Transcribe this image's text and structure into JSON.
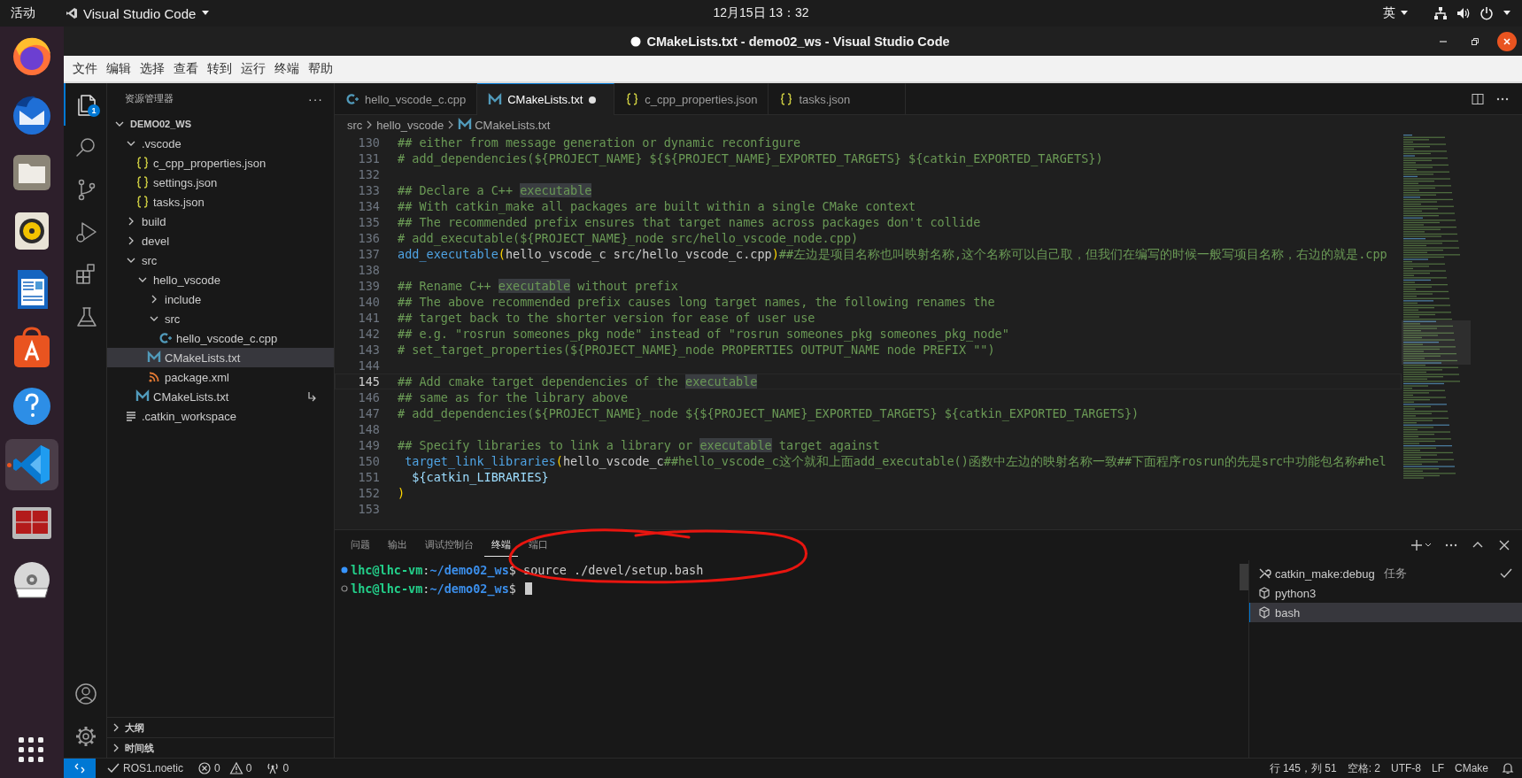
{
  "top_bar": {
    "activities": "活动",
    "app_menu": "Visual Studio Code",
    "clock": "12月15日 13：32",
    "input_method": "英"
  },
  "dock": {
    "items": [
      {
        "kind": "browser",
        "active": false
      },
      {
        "kind": "mail",
        "active": false
      },
      {
        "kind": "files",
        "active": false
      },
      {
        "kind": "music",
        "active": false
      },
      {
        "kind": "writer",
        "active": false
      },
      {
        "kind": "store",
        "active": false
      },
      {
        "kind": "help",
        "active": false
      },
      {
        "kind": "editor",
        "active": true
      },
      {
        "kind": "terminal",
        "active": false
      },
      {
        "kind": "disc",
        "active": false
      }
    ]
  },
  "window": {
    "title": "CMakeLists.txt - demo02_ws - Visual Studio Code",
    "modified": true
  },
  "menu": [
    "文件",
    "编辑",
    "选择",
    "查看",
    "转到",
    "运行",
    "终端",
    "帮助"
  ],
  "activity_bar": {
    "items": [
      {
        "kind": "explorer",
        "selected": true,
        "badge": "1"
      },
      {
        "kind": "search",
        "selected": false
      },
      {
        "kind": "scm",
        "selected": false
      },
      {
        "kind": "debug",
        "selected": false
      },
      {
        "kind": "extensions",
        "selected": false
      },
      {
        "kind": "testing",
        "selected": false
      }
    ]
  },
  "sidebar": {
    "title": "资源管理器",
    "more": "···",
    "tree": [
      {
        "label": "DEMO02_WS",
        "kind": "root",
        "expanded": true,
        "selected": false,
        "children": [
          {
            "label": ".vscode",
            "kind": "folder",
            "expanded": true,
            "selected": false,
            "children": [
              {
                "label": "c_cpp_properties.json",
                "kind": "json",
                "selected": false
              },
              {
                "label": "settings.json",
                "kind": "json",
                "selected": false
              },
              {
                "label": "tasks.json",
                "kind": "json",
                "selected": false
              }
            ]
          },
          {
            "label": "build",
            "kind": "folder",
            "expanded": false,
            "selected": false
          },
          {
            "label": "devel",
            "kind": "folder",
            "expanded": false,
            "selected": false
          },
          {
            "label": "src",
            "kind": "folder",
            "expanded": true,
            "selected": false,
            "children": [
              {
                "label": "hello_vscode",
                "kind": "folder",
                "expanded": true,
                "selected": false,
                "children": [
                  {
                    "label": "include",
                    "kind": "folder",
                    "expanded": false,
                    "selected": false
                  },
                  {
                    "label": "src",
                    "kind": "folder",
                    "expanded": true,
                    "selected": false,
                    "children": [
                      {
                        "label": "hello_vscode_c.cpp",
                        "kind": "cpp",
                        "selected": false
                      }
                    ]
                  },
                  {
                    "label": "CMakeLists.txt",
                    "kind": "cmake",
                    "selected": true
                  },
                  {
                    "label": "package.xml",
                    "kind": "xml",
                    "selected": false
                  }
                ]
              },
              {
                "label": "CMakeLists.txt",
                "kind": "cmake",
                "selected": false,
                "symlink": true
              }
            ]
          },
          {
            "label": ".catkin_workspace",
            "kind": "text",
            "selected": false
          }
        ]
      }
    ],
    "sections": [
      {
        "label": "大纲",
        "expanded": false
      },
      {
        "label": "时间线",
        "expanded": false
      }
    ]
  },
  "tabs": [
    {
      "label": "hello_vscode_c.cpp",
      "kind": "cpp",
      "selected": false,
      "modified": false
    },
    {
      "label": "CMakeLists.txt",
      "kind": "cmake",
      "selected": true,
      "modified": true
    },
    {
      "label": "c_cpp_properties.json",
      "kind": "json",
      "selected": false,
      "modified": false
    },
    {
      "label": "tasks.json",
      "kind": "json",
      "selected": false,
      "modified": false
    }
  ],
  "breadcrumb": [
    {
      "label": "src",
      "kind": "folder"
    },
    {
      "label": "hello_vscode",
      "kind": "folder"
    },
    {
      "label": "CMakeLists.txt",
      "kind": "cmake"
    }
  ],
  "code": [
    {
      "number": "130",
      "segments": [
        {
          "kind": "comment",
          "text": "## either from message generation or dynamic reconfigure"
        }
      ]
    },
    {
      "number": "131",
      "segments": [
        {
          "kind": "comment",
          "text": "# add_dependencies(${PROJECT_NAME} ${${PROJECT_NAME}_EXPORTED_TARGETS} ${catkin_EXPORTED_TARGETS})"
        }
      ]
    },
    {
      "number": "132"
    },
    {
      "number": "133",
      "segments": [
        {
          "kind": "comment",
          "text": "## Declare a C++ "
        },
        {
          "kind": "match",
          "text": "executable"
        }
      ]
    },
    {
      "number": "134",
      "segments": [
        {
          "kind": "comment",
          "text": "## With catkin_make all packages are built within a single CMake context"
        }
      ]
    },
    {
      "number": "135",
      "segments": [
        {
          "kind": "comment",
          "text": "## The recommended prefix ensures that target names across packages don't collide"
        }
      ]
    },
    {
      "number": "136",
      "segments": [
        {
          "kind": "comment",
          "text": "# add_executable(${PROJECT_NAME}_node src/hello_vscode_node.cpp)"
        }
      ]
    },
    {
      "number": "137",
      "segments": [
        {
          "kind": "command",
          "text": "add_executable"
        },
        {
          "kind": "paren",
          "text": "("
        },
        {
          "kind": "plain",
          "text": "hello_vscode_c src/hello_vscode_c.cpp"
        },
        {
          "kind": "paren",
          "text": ")"
        },
        {
          "kind": "comment",
          "text": "##左边是项目名称也叫映射名称,这个名称可以自己取，但我们在编写的时候一般写项目名称，右边的就是.cpp"
        }
      ]
    },
    {
      "number": "138"
    },
    {
      "number": "139",
      "segments": [
        {
          "kind": "comment",
          "text": "## Rename C++ "
        },
        {
          "kind": "match",
          "text": "executable"
        },
        {
          "kind": "comment",
          "text": " without prefix"
        }
      ]
    },
    {
      "number": "140",
      "segments": [
        {
          "kind": "comment",
          "text": "## The above recommended prefix causes long target names, the following renames the"
        }
      ]
    },
    {
      "number": "141",
      "segments": [
        {
          "kind": "comment",
          "text": "## target back to the shorter version for ease of user use"
        }
      ]
    },
    {
      "number": "142",
      "segments": [
        {
          "kind": "comment",
          "text": "## e.g. \"rosrun someones_pkg node\" instead of \"rosrun someones_pkg someones_pkg_node\""
        }
      ]
    },
    {
      "number": "143",
      "segments": [
        {
          "kind": "comment",
          "text": "# set_target_properties(${PROJECT_NAME}_node PROPERTIES OUTPUT_NAME node PREFIX \"\")"
        }
      ]
    },
    {
      "number": "144"
    },
    {
      "number": "145",
      "current": true,
      "segments": [
        {
          "kind": "comment",
          "text": "## Add cmake target dependencies of the "
        },
        {
          "kind": "match",
          "text": "executable"
        }
      ]
    },
    {
      "number": "146",
      "segments": [
        {
          "kind": "comment",
          "text": "## same as for the library above"
        }
      ]
    },
    {
      "number": "147",
      "segments": [
        {
          "kind": "comment",
          "text": "# add_dependencies(${PROJECT_NAME}_node ${${PROJECT_NAME}_EXPORTED_TARGETS} ${catkin_EXPORTED_TARGETS})"
        }
      ]
    },
    {
      "number": "148"
    },
    {
      "number": "149",
      "segments": [
        {
          "kind": "comment",
          "text": "## Specify libraries to link a library or "
        },
        {
          "kind": "match",
          "text": "executable"
        },
        {
          "kind": "comment",
          "text": " target against"
        }
      ]
    },
    {
      "number": "150",
      "segments": [
        {
          "kind": "command",
          "text": " target_link_libraries"
        },
        {
          "kind": "paren",
          "text": "("
        },
        {
          "kind": "plain",
          "text": "hello_vscode_c"
        },
        {
          "kind": "comment",
          "text": "##hello_vscode_c这个就和上面add_executable()函数中左边的映射名称一致##下面程序rosrun的先是src中功能包名称#hel"
        }
      ]
    },
    {
      "number": "151",
      "segments": [
        {
          "kind": "variable",
          "text": "  ${catkin_LIBRARIES}"
        }
      ]
    },
    {
      "number": "152",
      "segments": [
        {
          "kind": "paren",
          "text": ")"
        }
      ]
    },
    {
      "number": "153"
    }
  ],
  "panel": {
    "tabs": [
      {
        "label": "问题",
        "selected": false
      },
      {
        "label": "输出",
        "selected": false
      },
      {
        "label": "调试控制台",
        "selected": false
      },
      {
        "label": "终端",
        "selected": true
      },
      {
        "label": "端口",
        "selected": false
      }
    ],
    "terminal_lines": [
      {
        "finished": true,
        "user": "lhc@lhc-vm",
        "separator": ":",
        "path": "~/demo02_ws",
        "prompt": "$",
        "command": "source ./devel/setup.bash"
      },
      {
        "finished": false,
        "user": "lhc@lhc-vm",
        "separator": ":",
        "path": "~/demo02_ws",
        "prompt": "$",
        "cursor": true
      }
    ],
    "terminals": [
      {
        "label": "catkin_make:debug",
        "kind": "task",
        "tag": "任务",
        "done": true,
        "selected": false
      },
      {
        "label": "python3",
        "kind": "shell",
        "selected": false
      },
      {
        "label": "bash",
        "kind": "shell",
        "selected": true
      }
    ]
  },
  "status_bar": {
    "left": [
      {
        "kind": "check",
        "text": "ROS1.noetic"
      },
      {
        "kind": "error",
        "text": "0"
      },
      {
        "kind": "warning",
        "text": "0"
      },
      {
        "kind": "ports",
        "text": "0"
      }
    ],
    "right": [
      "行 145，列 51",
      "空格: 2",
      "UTF-8",
      "LF",
      "CMake"
    ]
  }
}
